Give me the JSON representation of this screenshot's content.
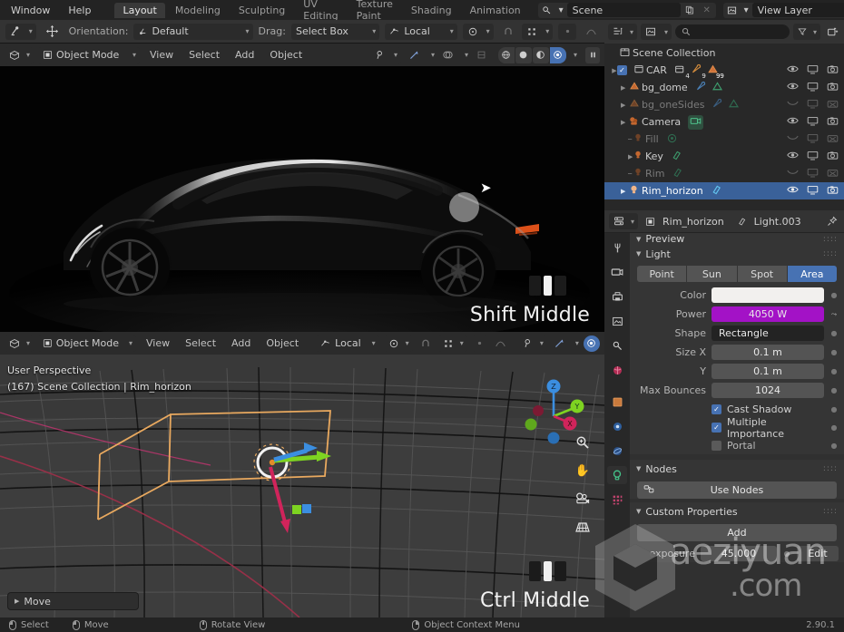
{
  "topbar": {
    "menus": [
      "Window",
      "Help"
    ],
    "workspace_tabs": [
      {
        "label": "Layout",
        "active": true
      },
      {
        "label": "Modeling",
        "active": false
      },
      {
        "label": "Sculpting",
        "active": false
      },
      {
        "label": "UV Editing",
        "active": false
      },
      {
        "label": "Texture Paint",
        "active": false
      },
      {
        "label": "Shading",
        "active": false
      },
      {
        "label": "Animation",
        "active": false
      }
    ],
    "scene_field": "Scene",
    "viewlayer_field": "View Layer"
  },
  "tool_settings": {
    "orientation_label": "Orientation:",
    "orientation_value": "Default",
    "drag_label": "Drag:",
    "drag_value": "Select Box",
    "transform_value": "Local"
  },
  "view1": {
    "mode": "Object Mode",
    "menus": [
      "View",
      "Select",
      "Add",
      "Object"
    ],
    "keyhint": "Shift Middle"
  },
  "view2": {
    "mode": "Object Mode",
    "menus": [
      "View",
      "Select",
      "Add",
      "Object"
    ],
    "transform_value": "Local",
    "perspective": "User Perspective",
    "scene_line": "(167) Scene Collection | Rim_horizon",
    "operator_panel": "Move",
    "keyhint": "Ctrl Middle",
    "gizmo_axes": [
      "X",
      "Y",
      "Z"
    ]
  },
  "outliner": {
    "search_placeholder": "",
    "root": "Scene Collection",
    "rows": [
      {
        "name": "CAR",
        "type": "collection",
        "checkbox": true,
        "dim": false,
        "selected": false,
        "depth": 1,
        "badges": [
          {
            "icon": "mesh-data",
            "count": "4"
          },
          {
            "icon": "modifier",
            "count": "9"
          },
          {
            "icon": "mesh-tri",
            "count": "99"
          }
        ],
        "visible": true,
        "screen": true,
        "camera": true
      },
      {
        "name": "bg_dome",
        "type": "mesh",
        "checkbox": false,
        "dim": false,
        "selected": false,
        "depth": 2,
        "badges": [
          {
            "icon": "modifier",
            "count": ""
          },
          {
            "icon": "mesh-tri",
            "count": ""
          }
        ],
        "visible": true,
        "screen": true,
        "camera": true
      },
      {
        "name": "bg_oneSides",
        "type": "mesh",
        "checkbox": false,
        "dim": true,
        "selected": false,
        "depth": 2,
        "badges": [
          {
            "icon": "modifier",
            "count": ""
          },
          {
            "icon": "mesh-tri",
            "count": ""
          }
        ],
        "visible": false,
        "screen": true,
        "camera": false
      },
      {
        "name": "Camera",
        "type": "camera",
        "checkbox": false,
        "dim": false,
        "selected": false,
        "depth": 2,
        "badges": [
          {
            "icon": "camera-data",
            "count": ""
          }
        ],
        "visible": true,
        "screen": true,
        "camera": true
      },
      {
        "name": "Fill",
        "type": "light",
        "checkbox": false,
        "dim": true,
        "selected": false,
        "depth": 3,
        "badges": [
          {
            "icon": "light-point",
            "count": ""
          }
        ],
        "visible": false,
        "screen": true,
        "camera": false
      },
      {
        "name": "Key",
        "type": "light",
        "checkbox": false,
        "dim": false,
        "selected": false,
        "depth": 3,
        "badges": [
          {
            "icon": "light-area",
            "count": ""
          }
        ],
        "visible": true,
        "screen": true,
        "camera": true
      },
      {
        "name": "Rim",
        "type": "light",
        "checkbox": false,
        "dim": true,
        "selected": false,
        "depth": 3,
        "badges": [
          {
            "icon": "light-area",
            "count": ""
          }
        ],
        "visible": false,
        "screen": true,
        "camera": false
      },
      {
        "name": "Rim_horizon",
        "type": "light",
        "checkbox": false,
        "dim": false,
        "selected": true,
        "depth": 2,
        "badges": [
          {
            "icon": "light-area",
            "count": ""
          }
        ],
        "visible": true,
        "screen": true,
        "camera": true
      }
    ]
  },
  "properties": {
    "breadcrumb_object": "Rim_horizon",
    "breadcrumb_data": "Light.003",
    "preview_panel": "Preview",
    "light_panel": "Light",
    "light_types": [
      {
        "label": "Point",
        "active": false
      },
      {
        "label": "Sun",
        "active": false
      },
      {
        "label": "Spot",
        "active": false
      },
      {
        "label": "Area",
        "active": true
      }
    ],
    "fields": [
      {
        "label": "Color",
        "value": "",
        "style": "white"
      },
      {
        "label": "Power",
        "value": "4050 W",
        "style": "purple"
      },
      {
        "label": "Shape",
        "value": "Rectangle",
        "style": "dark"
      },
      {
        "label": "Size X",
        "value": "0.1 m",
        "style": "grey"
      },
      {
        "label": "Y",
        "value": "0.1 m",
        "style": "grey"
      },
      {
        "label": "Max Bounces",
        "value": "1024",
        "style": "grey"
      }
    ],
    "checkboxes": [
      {
        "label": "Cast Shadow",
        "checked": true
      },
      {
        "label": "Multiple Importance",
        "checked": true
      },
      {
        "label": "Portal",
        "checked": false
      }
    ],
    "nodes_panel": "Nodes",
    "use_nodes_button": "Use Nodes",
    "custom_properties_panel": "Custom Properties",
    "add_button": "Add",
    "custom_prop_name": "exposure",
    "custom_prop_value": "45.000",
    "edit_button": "Edit"
  },
  "status": {
    "items": [
      {
        "label": "Select",
        "mouse": "left"
      },
      {
        "label": "Move",
        "mouse": "left-drag"
      },
      {
        "label": "Rotate View",
        "mouse": "middle"
      },
      {
        "label": "Object Context Menu",
        "mouse": "right"
      }
    ],
    "version": "2.90.1"
  },
  "watermark": {
    "text": "aeziyuan",
    "suffix": ".com"
  },
  "colors": {
    "accent_blue": "#4772b3",
    "power_purple": "#a312c6",
    "selection_orange": "#e5a457",
    "panel_bg": "#303030",
    "header_bg": "#333333"
  }
}
